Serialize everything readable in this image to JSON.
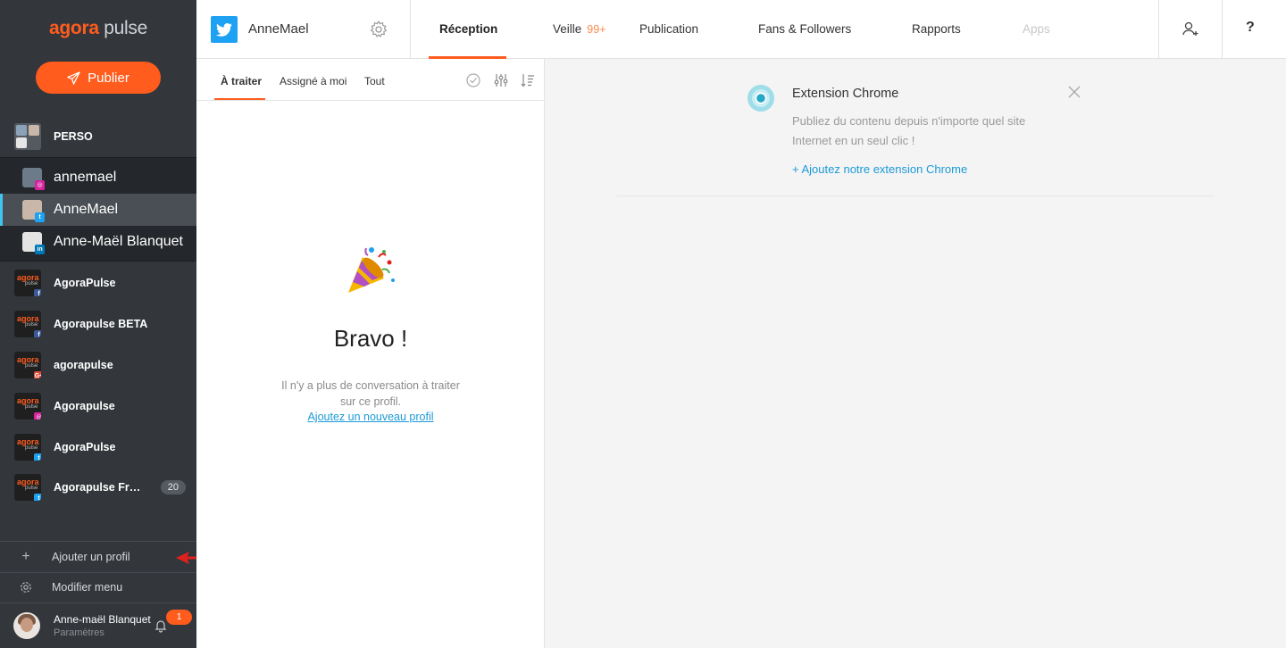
{
  "brand": {
    "part1": "agora",
    "part2": "pulse"
  },
  "sidebar": {
    "publish_label": "Publier",
    "group_name": "PERSO",
    "sub_profiles": [
      {
        "name": "annemael",
        "network": "instagram"
      },
      {
        "name": "AnneMael",
        "network": "twitter",
        "active": true
      },
      {
        "name": "Anne-Maël Blanquet",
        "network": "linkedin"
      }
    ],
    "profiles": [
      {
        "name": "AgoraPulse",
        "network": "facebook"
      },
      {
        "name": "Agorapulse BETA",
        "network": "facebook"
      },
      {
        "name": "agorapulse",
        "network": "google-plus"
      },
      {
        "name": "Agorapulse",
        "network": "instagram"
      },
      {
        "name": "AgoraPulse",
        "network": "twitter"
      },
      {
        "name": "Agorapulse Fran...",
        "network": "twitter",
        "count": "20"
      }
    ],
    "add_profile": "Ajouter un profil",
    "edit_menu": "Modifier menu",
    "user": {
      "name": "Anne-maël Blanquet",
      "sub": "Paramètres",
      "notifications": "1"
    }
  },
  "topbar": {
    "account_name": "AnneMael",
    "nav": {
      "reception": "Réception",
      "veille": "Veille",
      "veille_badge": "99+",
      "publication": "Publication",
      "fans": "Fans & Followers",
      "rapports": "Rapports",
      "apps": "Apps"
    },
    "help": "?"
  },
  "inbox": {
    "tabs": [
      "À traiter",
      "Assigné à moi",
      "Tout"
    ],
    "title": "Bravo !",
    "message": "Il n'y a plus de conversation à traiter sur ce profil.",
    "link": "Ajoutez un nouveau profil"
  },
  "card": {
    "title": "Extension Chrome",
    "text": "Publiez du contenu depuis n'importe quel site Internet en un seul clic !",
    "link": "+ Ajoutez notre extension Chrome"
  },
  "colors": {
    "accent": "#ff5c1e",
    "link": "#1c9ad6",
    "sidebar": "#33373c",
    "twitter": "#1da1f2"
  }
}
